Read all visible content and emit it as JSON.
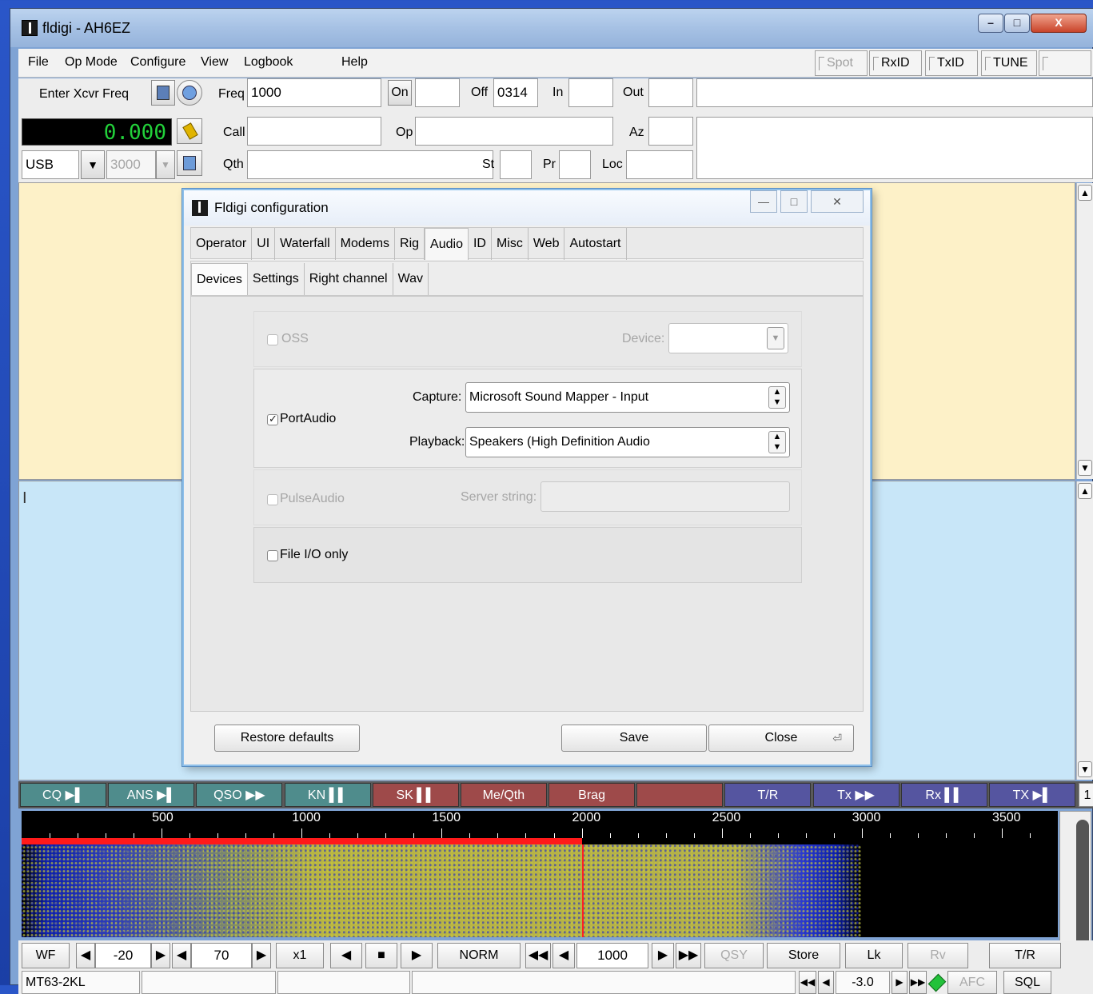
{
  "window": {
    "title": "fldigi - AH6EZ",
    "min": "–",
    "max": "□",
    "close": "X"
  },
  "menu": {
    "file": "File",
    "opmode": "Op Mode",
    "configure": "Configure",
    "view": "View",
    "logbook": "Logbook",
    "help": "Help",
    "spot": "Spot",
    "rxid": "RxID",
    "txid": "TxID",
    "tune": "TUNE"
  },
  "log": {
    "enter_freq": "Enter Xcvr Freq",
    "freq_label": "Freq",
    "freq_value": "1000",
    "on_label": "On",
    "on_value": "",
    "off_label": "Off",
    "off_value": "0314",
    "in_label": "In",
    "out_label": "Out",
    "call_label": "Call",
    "op_label": "Op",
    "az_label": "Az",
    "qth_label": "Qth",
    "st_label": "St",
    "pr_label": "Pr",
    "loc_label": "Loc",
    "freq_display": "0.000",
    "mode": "USB",
    "bandwidth": "3000"
  },
  "dialog": {
    "title": "Fldigi configuration",
    "tabs": [
      "Operator",
      "UI",
      "Waterfall",
      "Modems",
      "Rig",
      "Audio",
      "ID",
      "Misc",
      "Web",
      "Autostart"
    ],
    "active_tab": "Audio",
    "subtabs": [
      "Devices",
      "Settings",
      "Right channel",
      "Wav"
    ],
    "active_subtab": "Devices",
    "oss_label": "OSS",
    "device_label": "Device:",
    "portaudio_label": "PortAudio",
    "portaudio_checked": true,
    "capture_label": "Capture:",
    "capture_value": "Microsoft Sound Mapper - Input",
    "playback_label": "Playback:",
    "playback_value": "Speakers (High Definition Audio",
    "pulseaudio_label": "PulseAudio",
    "server_label": "Server string:",
    "fileio_label": "File I/O only",
    "restore_label": "Restore defaults",
    "save_label": "Save",
    "close_label": "Close"
  },
  "macros": [
    {
      "label": "CQ ▶▌",
      "color": "#4f8c8c"
    },
    {
      "label": "ANS ▶▌",
      "color": "#4f8c8c"
    },
    {
      "label": "QSO ▶▶",
      "color": "#4f8c8c"
    },
    {
      "label": "KN ▌▌",
      "color": "#4f8c8c"
    },
    {
      "label": "SK ▌▌",
      "color": "#9e4a4a"
    },
    {
      "label": "Me/Qth",
      "color": "#9e4a4a"
    },
    {
      "label": "Brag",
      "color": "#9e4a4a"
    },
    {
      "label": "",
      "color": "#9e4a4a"
    },
    {
      "label": "T/R",
      "color": "#5555a0"
    },
    {
      "label": "Tx ▶▶",
      "color": "#5555a0"
    },
    {
      "label": "Rx ▌▌",
      "color": "#5555a0"
    },
    {
      "label": "TX ▶▌",
      "color": "#5555a0"
    }
  ],
  "macro_page": "1",
  "scale": {
    "ticks": [
      "500",
      "1000",
      "1500",
      "2000",
      "2500",
      "3000",
      "3500"
    ],
    "cursor_freq": 2000
  },
  "wfbar": {
    "wf": "WF",
    "ref_level": "-20",
    "range": "70",
    "zoom": "x1",
    "norm": "NORM",
    "freq": "1000",
    "qsy": "QSY",
    "store": "Store",
    "lk": "Lk",
    "rv": "Rv",
    "tr": "T/R"
  },
  "status": {
    "mode": "MT63-2KL",
    "s2n": "-3.0",
    "afc": "AFC",
    "sql": "SQL"
  }
}
